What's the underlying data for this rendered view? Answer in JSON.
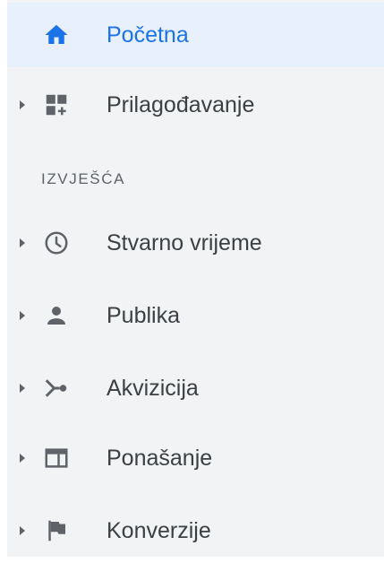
{
  "nav": {
    "home": {
      "label": "Početna",
      "icon": "home-icon"
    },
    "customization": {
      "label": "Prilagođavanje",
      "icon": "dashboard-add-icon"
    },
    "section_title": "IZVJEŠĆA",
    "items": [
      {
        "label": "Stvarno vrijeme",
        "icon": "clock-icon"
      },
      {
        "label": "Publika",
        "icon": "person-icon"
      },
      {
        "label": "Akvizicija",
        "icon": "acquisition-icon"
      },
      {
        "label": "Ponašanje",
        "icon": "behavior-icon"
      },
      {
        "label": "Konverzije",
        "icon": "flag-icon"
      }
    ]
  },
  "colors": {
    "accent": "#1a73e8",
    "active_bg": "#e8f0fe",
    "sidebar_bg": "#f1f3f4",
    "text": "#3c4043",
    "icon": "#5f6368"
  }
}
